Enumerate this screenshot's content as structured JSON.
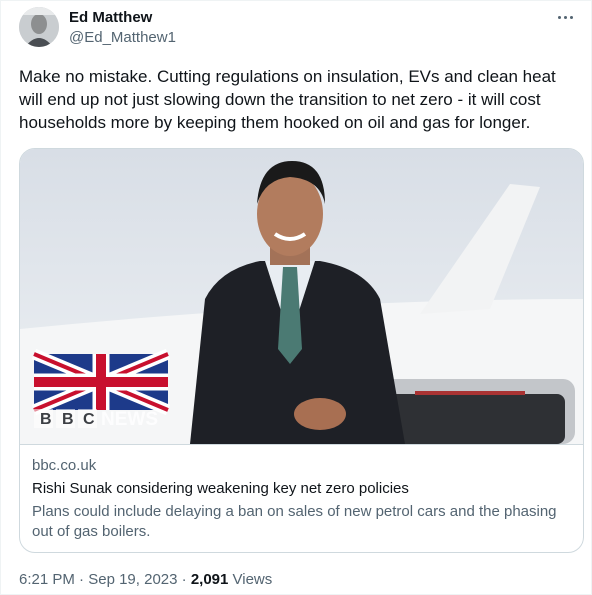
{
  "author": {
    "name": "Ed Matthew",
    "handle": "@Ed_Matthew1"
  },
  "tweet": {
    "text": "Make no mistake. Cutting regulations on insulation, EVs and clean heat will end up not just slowing down the transition to net zero - it will cost households more by keeping them hooked on oil and gas for longer."
  },
  "card": {
    "image_watermark": "BBC NEWS",
    "domain": "bbc.co.uk",
    "title": "Rishi Sunak considering weakening key net zero policies",
    "description": "Plans could include delaying a ban on sales of new petrol cars and the phasing out of gas boilers."
  },
  "meta": {
    "time": "6:21 PM",
    "separator": " · ",
    "date": "Sep 19, 2023",
    "views_count": "2,091",
    "views_label": " Views"
  },
  "icons": {
    "more": "more-horizontal-icon"
  },
  "colors": {
    "text_primary": "#0f1419",
    "text_secondary": "#536471",
    "border": "#cfd9de"
  }
}
